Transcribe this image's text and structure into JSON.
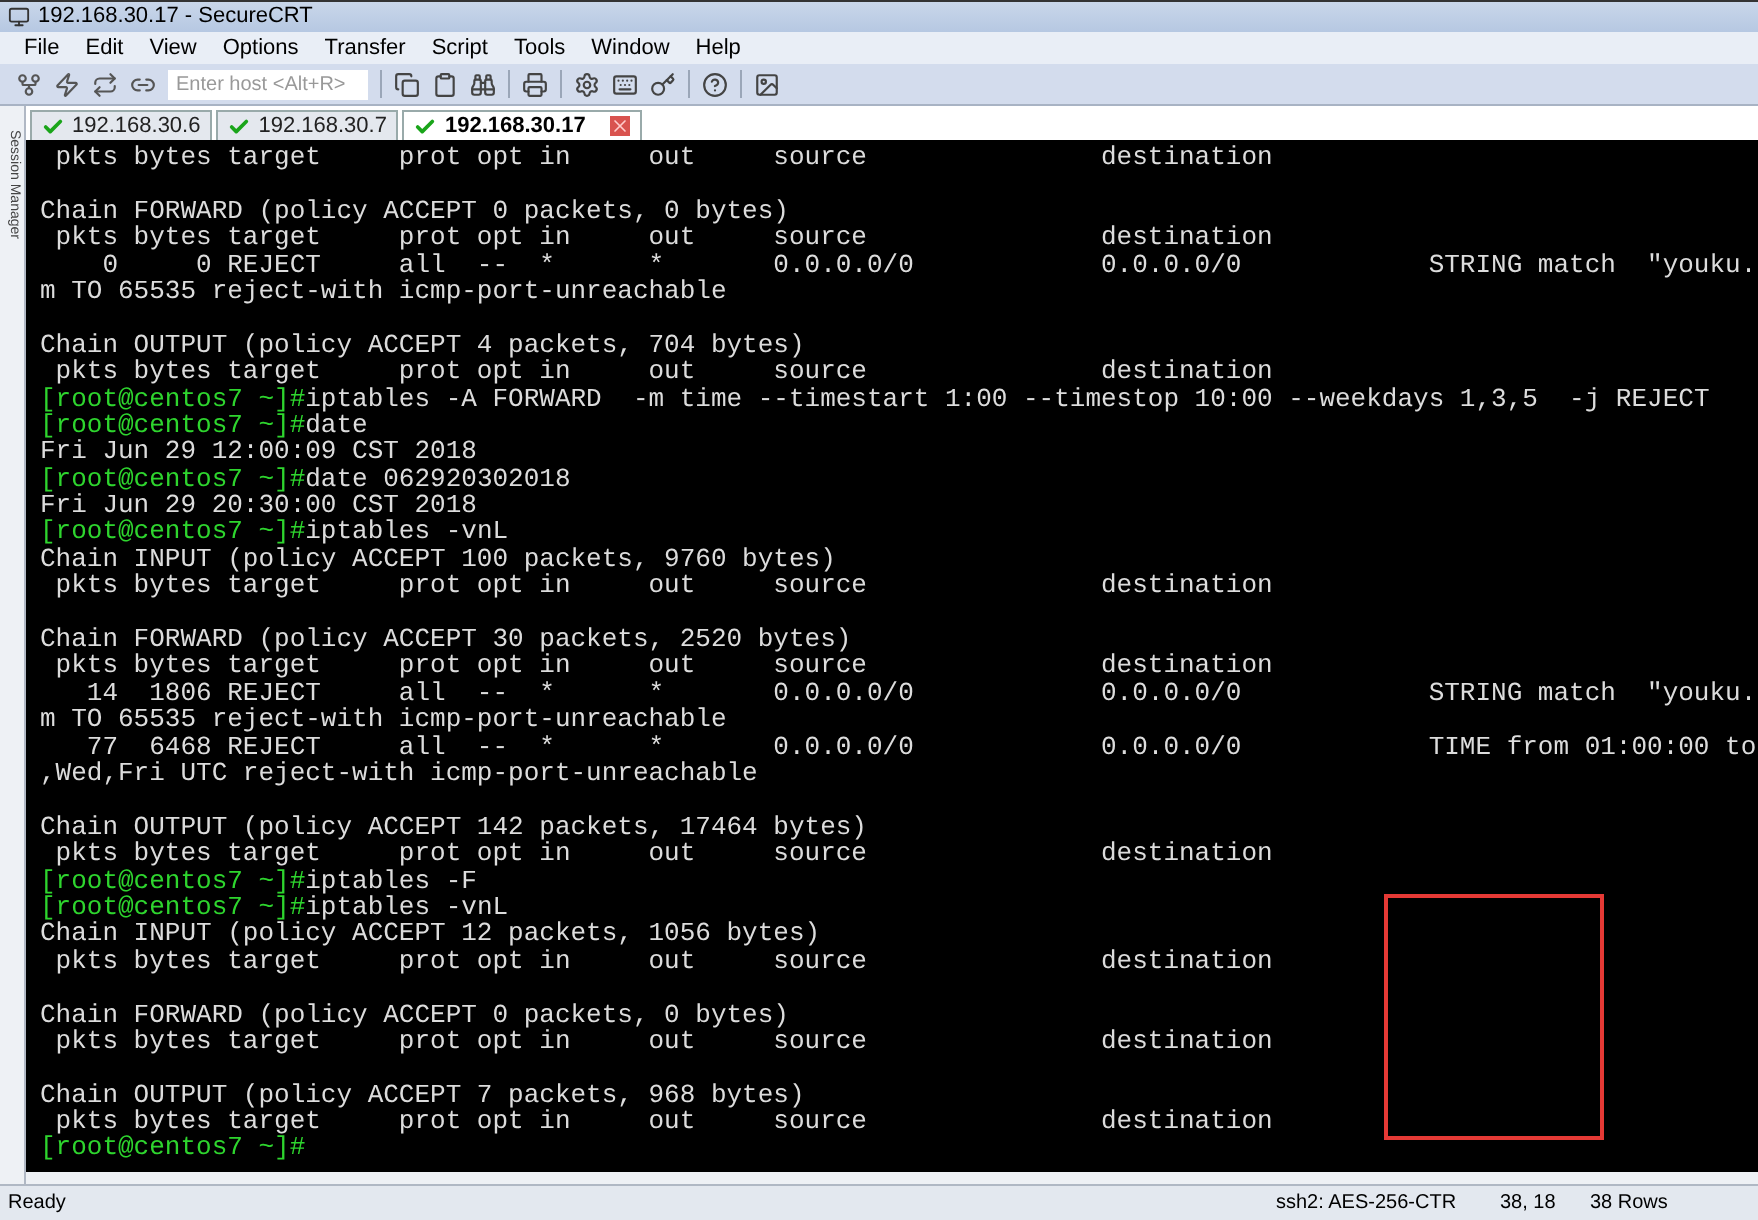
{
  "window": {
    "title": "192.168.30.17 - SecureCRT"
  },
  "menu": [
    "File",
    "Edit",
    "View",
    "Options",
    "Transfer",
    "Script",
    "Tools",
    "Window",
    "Help"
  ],
  "toolbar": {
    "host_field": {
      "placeholder": "Enter host <Alt+R>"
    }
  },
  "session_manager": {
    "label": "Session Manager"
  },
  "tabs": [
    {
      "label": "192.168.30.6",
      "selected": false
    },
    {
      "label": "192.168.30.7",
      "selected": false
    },
    {
      "label": "192.168.30.17",
      "selected": true
    }
  ],
  "terminal": {
    "lines": [
      {
        "kind": "output",
        "text": " pkts bytes target     prot opt in     out     source               destination"
      },
      {
        "kind": "blank"
      },
      {
        "kind": "output",
        "text": "Chain FORWARD (policy ACCEPT 0 packets, 0 bytes)"
      },
      {
        "kind": "output",
        "text": " pkts bytes target     prot opt in     out     source               destination"
      },
      {
        "kind": "output",
        "text": "    0     0 REJECT     all  --  *      *       0.0.0.0/0            0.0.0.0/0            STRING match  \"youku."
      },
      {
        "kind": "output",
        "text": "m TO 65535 reject-with icmp-port-unreachable"
      },
      {
        "kind": "blank"
      },
      {
        "kind": "output",
        "text": "Chain OUTPUT (policy ACCEPT 4 packets, 704 bytes)"
      },
      {
        "kind": "output",
        "text": " pkts bytes target     prot opt in     out     source               destination"
      },
      {
        "kind": "prompt",
        "prompt": "[root@centos7 ~]#",
        "command": "iptables -A FORWARD  -m time --timestart 1:00 --timestop 10:00 --weekdays 1,3,5  -j REJECT"
      },
      {
        "kind": "prompt",
        "prompt": "[root@centos7 ~]#",
        "command": "date"
      },
      {
        "kind": "output",
        "text": "Fri Jun 29 12:00:09 CST 2018"
      },
      {
        "kind": "prompt",
        "prompt": "[root@centos7 ~]#",
        "command": "date 062920302018"
      },
      {
        "kind": "output",
        "text": "Fri Jun 29 20:30:00 CST 2018"
      },
      {
        "kind": "prompt",
        "prompt": "[root@centos7 ~]#",
        "command": "iptables -vnL"
      },
      {
        "kind": "output",
        "text": "Chain INPUT (policy ACCEPT 100 packets, 9760 bytes)"
      },
      {
        "kind": "output",
        "text": " pkts bytes target     prot opt in     out     source               destination"
      },
      {
        "kind": "blank"
      },
      {
        "kind": "output",
        "text": "Chain FORWARD (policy ACCEPT 30 packets, 2520 bytes)"
      },
      {
        "kind": "output",
        "text": " pkts bytes target     prot opt in     out     source               destination"
      },
      {
        "kind": "output",
        "text": "   14  1806 REJECT     all  --  *      *       0.0.0.0/0            0.0.0.0/0            STRING match  \"youku."
      },
      {
        "kind": "output",
        "text": "m TO 65535 reject-with icmp-port-unreachable"
      },
      {
        "kind": "output",
        "text": "   77  6468 REJECT     all  --  *      *       0.0.0.0/0            0.0.0.0/0            TIME from 01:00:00 to"
      },
      {
        "kind": "output",
        "text": ",Wed,Fri UTC reject-with icmp-port-unreachable"
      },
      {
        "kind": "blank"
      },
      {
        "kind": "output",
        "text": "Chain OUTPUT (policy ACCEPT 142 packets, 17464 bytes)"
      },
      {
        "kind": "output",
        "text": " pkts bytes target     prot opt in     out     source               destination"
      },
      {
        "kind": "prompt",
        "prompt": "[root@centos7 ~]#",
        "command": "iptables -F"
      },
      {
        "kind": "prompt",
        "prompt": "[root@centos7 ~]#",
        "command": "iptables -vnL"
      },
      {
        "kind": "output",
        "text": "Chain INPUT (policy ACCEPT 12 packets, 1056 bytes)"
      },
      {
        "kind": "output",
        "text": " pkts bytes target     prot opt in     out     source               destination"
      },
      {
        "kind": "blank"
      },
      {
        "kind": "output",
        "text": "Chain FORWARD (policy ACCEPT 0 packets, 0 bytes)"
      },
      {
        "kind": "output",
        "text": " pkts bytes target     prot opt in     out     source               destination"
      },
      {
        "kind": "blank"
      },
      {
        "kind": "output",
        "text": "Chain OUTPUT (policy ACCEPT 7 packets, 968 bytes)"
      },
      {
        "kind": "output",
        "text": " pkts bytes target     prot opt in     out     source               destination"
      },
      {
        "kind": "prompt",
        "prompt": "[root@centos7 ~]#"
      }
    ]
  },
  "status_bar": {
    "status": "Ready",
    "cipher": "ssh2: AES-256-CTR",
    "cursor": "38, 18",
    "rows": "38 Rows"
  }
}
